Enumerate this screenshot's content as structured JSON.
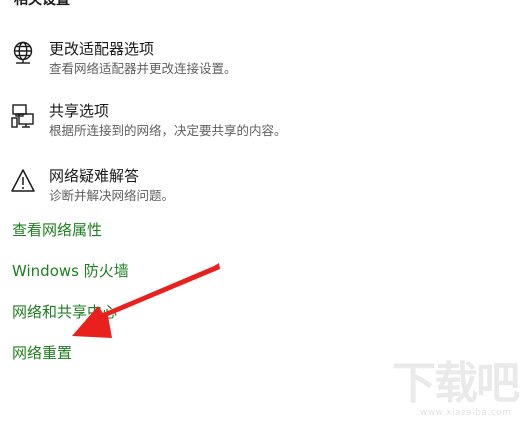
{
  "settings": [
    {
      "title": "更改适配器选项",
      "description": "查看网络适配器并更改连接设置。",
      "icon": "network-adapter-icon"
    },
    {
      "title": "共享选项",
      "description": "根据所连接到的网络，决定要共享的内容。",
      "icon": "sharing-icon"
    },
    {
      "title": "网络疑难解答",
      "description": "诊断并解决网络问题。",
      "icon": "warning-icon"
    }
  ],
  "links": [
    "查看网络属性",
    "Windows 防火墙",
    "网络和共享中心",
    "网络重置"
  ],
  "colors": {
    "link": "#1e7f1e",
    "arrow": "#e8211f",
    "text": "#1a1a1a",
    "subtext": "#5f5f5f"
  },
  "watermark": {
    "brand": "下载吧",
    "domain": "www.xiazaiba.com"
  }
}
